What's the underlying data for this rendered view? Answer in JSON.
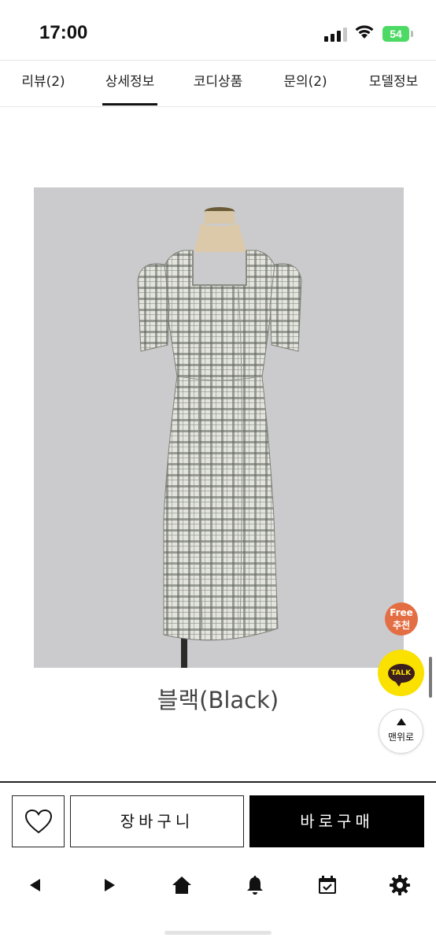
{
  "status_bar": {
    "time": "17:00",
    "battery": "54"
  },
  "tabs": [
    {
      "label": "리뷰(2)"
    },
    {
      "label": "상세정보"
    },
    {
      "label": "코디상품"
    },
    {
      "label": "문의(2)"
    },
    {
      "label": "모델정보"
    }
  ],
  "active_tab": "상세정보",
  "product": {
    "caption": "블랙(Black)"
  },
  "floating": {
    "free_line1": "Free",
    "free_line2": "추천",
    "talk_label": "TALK",
    "top_label": "맨위로"
  },
  "actions": {
    "cart_label": "장바구니",
    "buy_label": "바로구매"
  },
  "bottom_nav": {
    "icons": [
      "back-icon",
      "forward-icon",
      "home-icon",
      "bell-icon",
      "calendar-check-icon",
      "gear-icon"
    ]
  },
  "colors": {
    "accent": "#000000",
    "talk_yellow": "#fae100",
    "free_orange": "#e36e43",
    "battery_green": "#4cd964"
  }
}
